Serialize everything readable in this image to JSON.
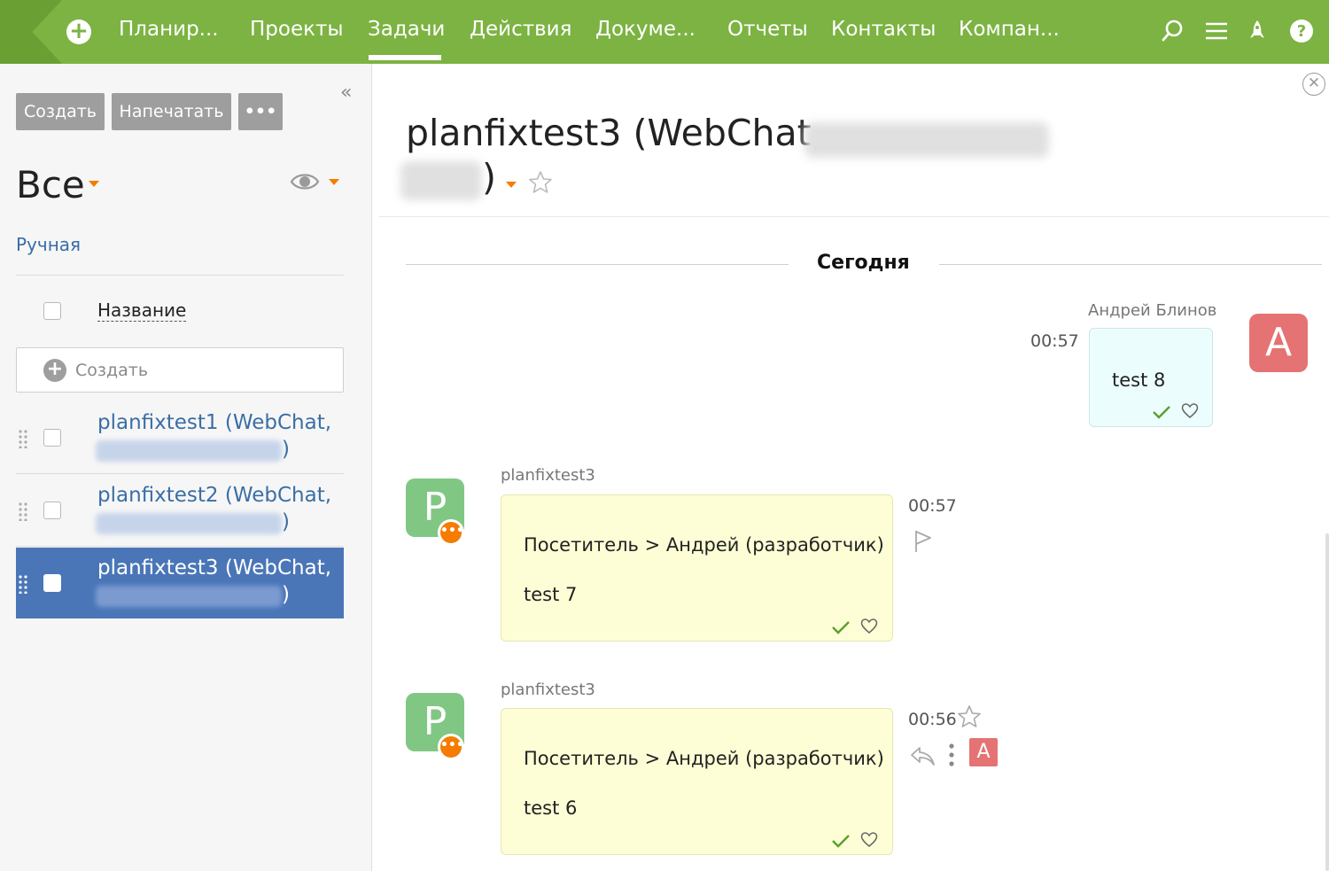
{
  "nav": {
    "items": [
      "Планир...",
      "Проекты",
      "Задачи",
      "Действия",
      "Докуме...",
      "Отчеты",
      "Контакты",
      "Компан..."
    ],
    "active": "Задачи",
    "accent": "#7cb342",
    "icons": [
      "add-icon",
      "search-icon",
      "menu-icon",
      "rocket-icon",
      "help-icon"
    ]
  },
  "sidebar": {
    "buttons": {
      "create": "Создать",
      "print": "Напечатать",
      "more": "•••"
    },
    "collapse": "«",
    "filter": "Все",
    "manual": "Ручная",
    "column": "Название",
    "create_row": "Создать",
    "tasks": [
      {
        "title": "planfixtest1 (WebChat,",
        "tail": ")"
      },
      {
        "title": "planfixtest2 (WebChat,",
        "tail": ")"
      },
      {
        "title": "planfixtest3 (WebChat,",
        "tail": ")",
        "active": true
      }
    ]
  },
  "main": {
    "title": "planfixtest3 (WebChat,",
    "title_tail": ")",
    "close": "✕",
    "day": "Сегодня",
    "messages": [
      {
        "sender": "Андрей Блинов",
        "time": "00:57",
        "text": "test 8",
        "avatar": "A",
        "avatar_color": "#e57373"
      },
      {
        "sender": "planfixtest3",
        "time": "00:57",
        "line1": "Посетитель > Андрей (разработчик)",
        "text": "test 7",
        "avatar": "P",
        "avatar_color": "#81c784"
      },
      {
        "sender": "planfixtest3",
        "time": "00:56",
        "line1": "Посетитель > Андрей (разработчик)",
        "text": "test 6",
        "avatar": "P",
        "avatar_color": "#81c784",
        "assignee": "A"
      }
    ]
  }
}
